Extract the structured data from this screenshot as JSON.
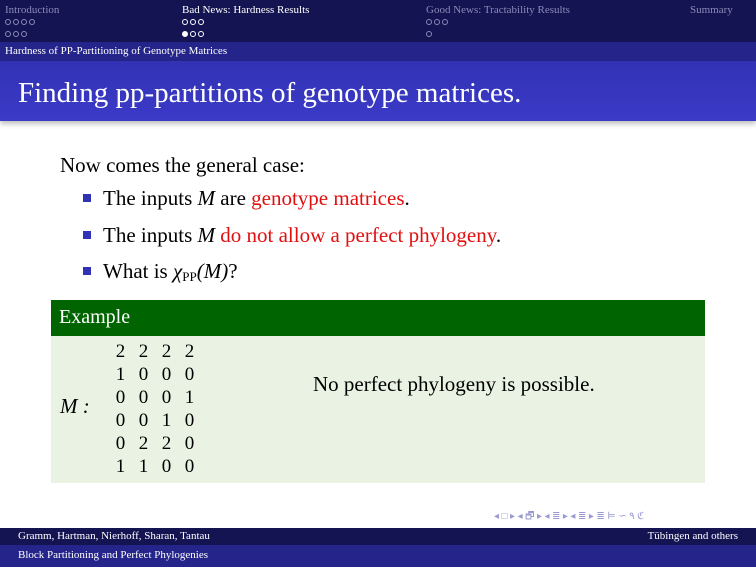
{
  "nav": {
    "sections": [
      {
        "title": "Introduction",
        "rows": [
          [
            0,
            0,
            0,
            0
          ],
          [
            0,
            0,
            0
          ]
        ],
        "active": false
      },
      {
        "title": "Bad News: Hardness Results",
        "rows": [
          [
            0,
            0,
            0
          ],
          [
            1,
            0,
            0
          ]
        ],
        "active": true
      },
      {
        "title": "Good News: Tractability Results",
        "rows": [
          [
            0,
            0,
            0
          ],
          [
            0
          ]
        ],
        "active": false
      },
      {
        "title": "Summary",
        "rows": [],
        "active": false
      }
    ],
    "subsection": "Hardness of PP-Partitioning of Genotype Matrices"
  },
  "frame": {
    "title": "Finding pp-partitions of genotype matrices.",
    "intro": "Now comes the general case:",
    "bullets": [
      {
        "pre": "The inputs ",
        "math": "M",
        "mid": " are ",
        "red": "genotype matrices",
        "post": "."
      },
      {
        "pre": "The inputs ",
        "math": "M",
        "mid": " ",
        "red": "do not allow a perfect phylogeny",
        "post": "."
      },
      {
        "pre": "What is ",
        "chi": "χ",
        "sub": "PP",
        "arg": "(M)",
        "post": "?"
      }
    ]
  },
  "example": {
    "title": "Example",
    "label": "M :",
    "matrix": [
      [
        "2",
        "2",
        "2",
        "2"
      ],
      [
        "1",
        "0",
        "0",
        "0"
      ],
      [
        "0",
        "0",
        "0",
        "1"
      ],
      [
        "0",
        "0",
        "1",
        "0"
      ],
      [
        "0",
        "2",
        "2",
        "0"
      ],
      [
        "1",
        "1",
        "0",
        "0"
      ]
    ],
    "note": "No perfect phylogeny is possible."
  },
  "beamer_nav": "◂ □ ▸ ◂ 🗗 ▸ ◂ ≣ ▸ ◂ ≣ ▸ ≣ ⊨ ∽ ۹ ℭ",
  "footer": {
    "authors": "Gramm, Hartman, Nierhoff, Sharan, Tantau",
    "institute": "Tübingen and others",
    "talk_title": "Block Partitioning and Perfect Phylogenies"
  },
  "colors": {
    "nav_bg": "#141452",
    "title_bg": "#3232b4",
    "accent_red": "#e01010",
    "block_head": "#006400",
    "block_body": "#eaf2e4"
  }
}
